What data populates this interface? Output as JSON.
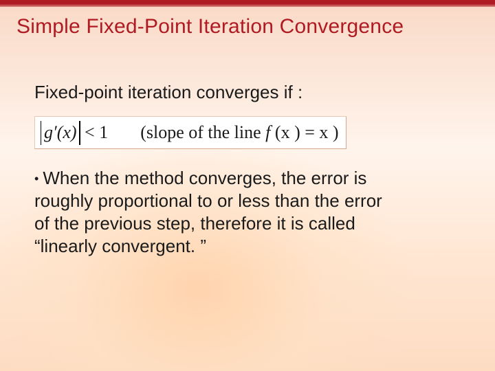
{
  "slide": {
    "title": "Simple Fixed-Point Iteration Convergence",
    "lead": "Fixed-point iteration converges if :",
    "formula": {
      "abs_expr": "g′(x)",
      "op": "< 1",
      "note_open": "(slope of the line ",
      "note_fn": "f ",
      "note_args": "(x ) = x ",
      "note_close": ")"
    },
    "bullet": "When the method converges, the error is roughly proportional to or less than the error of the previous step, therefore it is called “linearly convergent. ”"
  }
}
